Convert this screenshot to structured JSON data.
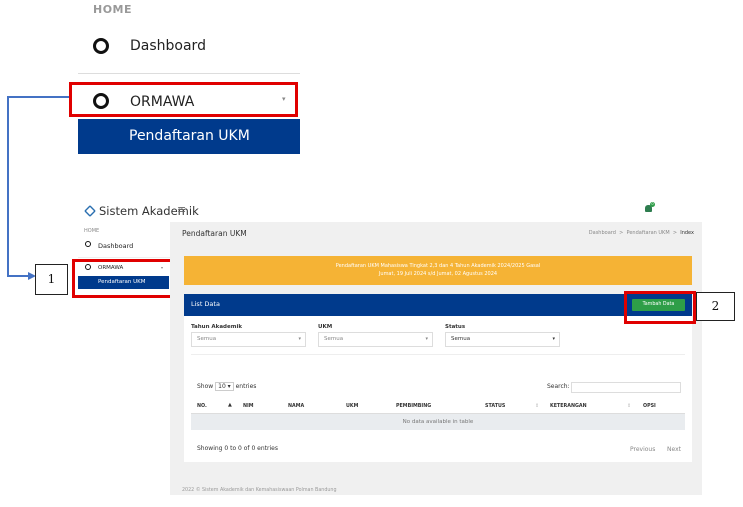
{
  "zoom": {
    "home": "HOME",
    "dashboard": "Dashboard",
    "ormawa": "ORMAWA",
    "pendaftaran": "Pendaftaran UKM"
  },
  "callouts": {
    "one": "1",
    "two": "2"
  },
  "app": {
    "brand": "Sistem Akademik",
    "notif_count": "0",
    "sidebar": {
      "home": "HOME",
      "dashboard": "Dashboard",
      "ormawa": "ORMAWA",
      "pendaftaran": "Pendaftaran UKM"
    },
    "page_title": "Pendaftaran UKM",
    "breadcrumb": [
      "Dashboard",
      ">",
      "Pendaftaran UKM",
      ">",
      "Index"
    ],
    "banner_line1": "Pendaftaran UKM Mahasiswa Tingkat 2,3 dan 4 Tahun Akademik 2024/2025 Gasal",
    "banner_line2": "Jumat, 19 Juli 2024 s/d Jumat, 02 Agustus 2024",
    "list_title": "List Data",
    "add_button": "Tambah Data",
    "filters": {
      "tahun_label": "Tahun Akademik",
      "tahun_value": "Semua",
      "ukm_label": "UKM",
      "ukm_value": "Semua",
      "status_label": "Status",
      "status_value": "Semua"
    },
    "show": "Show",
    "show_value": "10",
    "entries": "entries",
    "search_label": "Search:",
    "columns": [
      "NO.",
      "NIM",
      "NAMA",
      "UKM",
      "PEMBIMBING",
      "STATUS",
      "KETERANGAN",
      "OPSI"
    ],
    "empty": "No data available in table",
    "showing": "Showing 0 to 0 of 0 entries",
    "previous": "Previous",
    "next": "Next",
    "footer": "2022 © Sistem Akademik dan Kemahasiswaan Polman Bandung"
  },
  "colors": {
    "navy": "#003a8c",
    "banner": "#f5b335",
    "green": "#2e9e48",
    "red": "#e00000",
    "arrow": "#4472c4"
  }
}
